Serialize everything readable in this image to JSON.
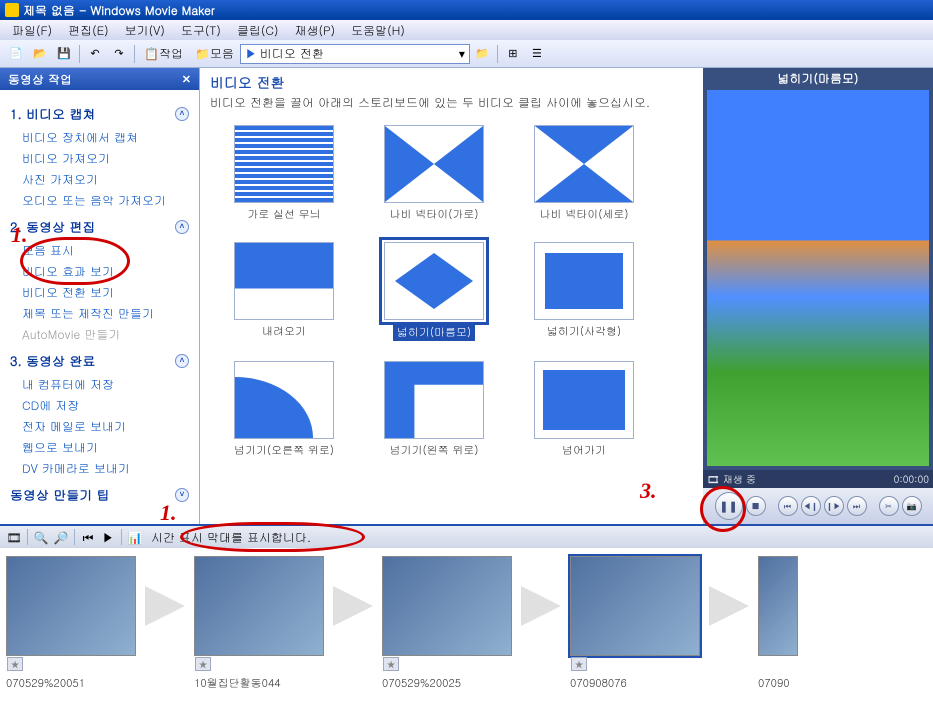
{
  "window": {
    "title": "제목 없음 - Windows Movie Maker"
  },
  "menu": {
    "file": "파일(F)",
    "edit": "편집(E)",
    "view": "보기(V)",
    "tools": "도구(T)",
    "clip": "클립(C)",
    "play": "재생(P)",
    "help": "도움말(H)"
  },
  "toolbar": {
    "tasks": "작업",
    "collections": "모음",
    "combo_value": "비디오 전환"
  },
  "taskpane": {
    "header": "동영상 작업",
    "s1": {
      "title": "1. 비디오 캡쳐",
      "links": [
        "비디오 장치에서 캡쳐",
        "비디오 가져오기",
        "사진 가져오기",
        "오디오 또는 음악 가져오기"
      ]
    },
    "s2": {
      "title": "2. 동영상 편집",
      "links": [
        "모음 표시",
        "비디오 효과 보기",
        "비디오 전환 보기",
        "제목 또는 제작진 만들기",
        "AutoMovie 만들기"
      ]
    },
    "s3": {
      "title": "3. 동영상 완료",
      "links": [
        "내 컴퓨터에 저장",
        "CD에 저장",
        "전자 메일로 보내기",
        "웹으로 보내기",
        "DV 카메라로 보내기"
      ]
    },
    "tips": "동영상 만들기 팁"
  },
  "content": {
    "title": "비디오 전환",
    "subtitle": "비디오 전환을 끌어 아래의 스토리보드에 있는 두 비디오 클립 사이에 놓으십시오.",
    "items": [
      {
        "label": "가로 실선 무늬"
      },
      {
        "label": "나비 넥타이(가로)"
      },
      {
        "label": "나비 넥타이(세로)"
      },
      {
        "label": "내려오기"
      },
      {
        "label": "넓히기(마름모)",
        "selected": true
      },
      {
        "label": "넓히기(사각형)"
      },
      {
        "label": "넘기기(오른쪽 위로)"
      },
      {
        "label": "넘기기(왼쪽 위로)"
      },
      {
        "label": "넘어가기"
      }
    ]
  },
  "preview": {
    "title": "넓히기(마름모)",
    "status": "재생 중",
    "time": "0:00:00"
  },
  "timeline": {
    "toggle_label": "시간 표시 막대를 표시합니다.",
    "clips": [
      {
        "label": "070529%20051"
      },
      {
        "label": "10월집단활동044"
      },
      {
        "label": "070529%20025"
      },
      {
        "label": "070908076",
        "selected": true
      },
      {
        "label": "07090"
      }
    ]
  },
  "annotations": {
    "n1": "1.",
    "n1b": "1.",
    "n3": "3."
  }
}
